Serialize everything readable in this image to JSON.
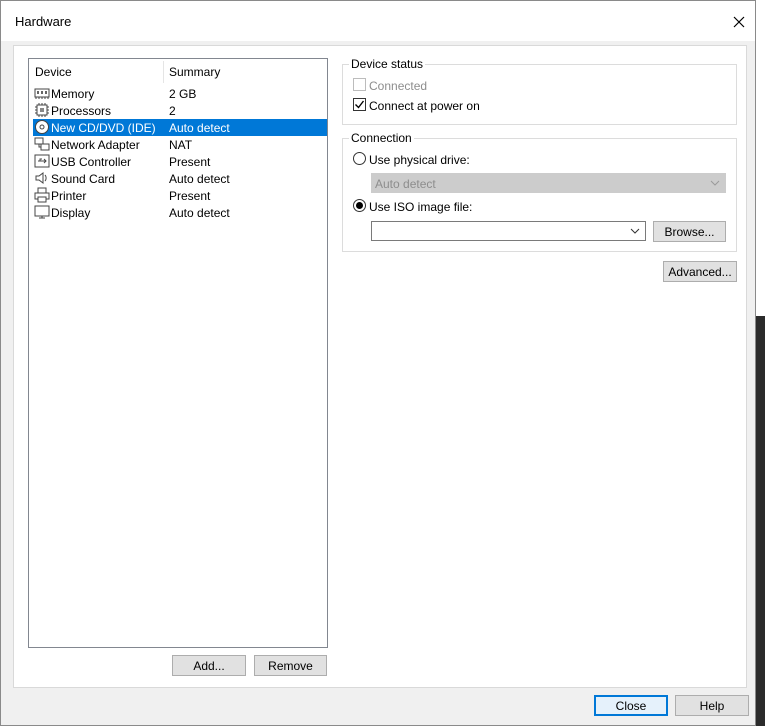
{
  "window": {
    "title": "Hardware"
  },
  "device_list": {
    "columns": [
      "Device",
      "Summary"
    ],
    "rows": [
      {
        "icon": "memory-icon",
        "device": "Memory",
        "summary": "2 GB"
      },
      {
        "icon": "processor-icon",
        "device": "Processors",
        "summary": "2"
      },
      {
        "icon": "cd-dvd-icon",
        "device": "New CD/DVD (IDE)",
        "summary": "Auto detect",
        "selected": true
      },
      {
        "icon": "network-adapter-icon",
        "device": "Network Adapter",
        "summary": "NAT"
      },
      {
        "icon": "usb-controller-icon",
        "device": "USB Controller",
        "summary": "Present"
      },
      {
        "icon": "sound-card-icon",
        "device": "Sound Card",
        "summary": "Auto detect"
      },
      {
        "icon": "printer-icon",
        "device": "Printer",
        "summary": "Present"
      },
      {
        "icon": "display-icon",
        "device": "Display",
        "summary": "Auto detect"
      }
    ]
  },
  "list_buttons": {
    "add": "Add...",
    "remove": "Remove"
  },
  "device_status": {
    "title": "Device status",
    "connected": {
      "label": "Connected",
      "checked": false,
      "enabled": false
    },
    "connect_at_power_on": {
      "label": "Connect at power on",
      "checked": true,
      "enabled": true
    }
  },
  "connection": {
    "title": "Connection",
    "physical_drive": {
      "label": "Use physical drive:",
      "selected": false
    },
    "physical_drive_value": "Auto detect",
    "iso_image": {
      "label": "Use ISO image file:",
      "selected": true
    },
    "iso_path": "",
    "browse": "Browse..."
  },
  "advanced": "Advanced...",
  "footer": {
    "close": "Close",
    "help": "Help"
  },
  "colors": {
    "selection": "#0078d7",
    "window_bg": "#f0f0f0"
  }
}
